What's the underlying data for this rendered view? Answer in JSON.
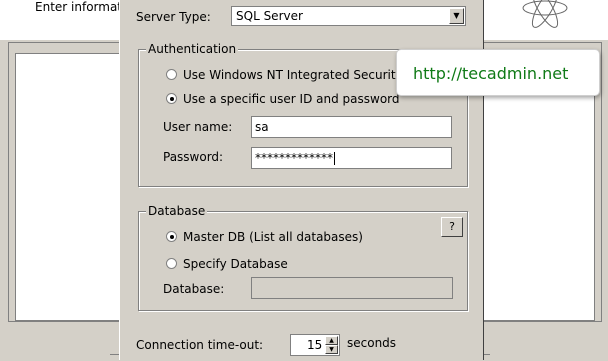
{
  "background": {
    "note": "Enter informati"
  },
  "dialog": {
    "server_type_label": "Server Type:",
    "server_type_value": "SQL Server",
    "authentication": {
      "title": "Authentication",
      "option_nt": "Use Windows NT Integrated Security",
      "option_user": "Use a specific user ID and password",
      "selected": "option_user",
      "username_label": "User name:",
      "username_value": "sa",
      "password_label": "Password:",
      "password_value": "*************"
    },
    "database": {
      "title": "Database",
      "help_label": "?",
      "option_master": "Master DB (List all databases)",
      "option_specify": "Specify Database",
      "selected": "option_master",
      "database_label": "Database:",
      "database_value": ""
    },
    "timeout": {
      "label": "Connection time-out:",
      "value": "15",
      "unit": "seconds"
    }
  },
  "tooltip": {
    "text": "http://tecadmin.net",
    "color": "#0f7a16"
  }
}
